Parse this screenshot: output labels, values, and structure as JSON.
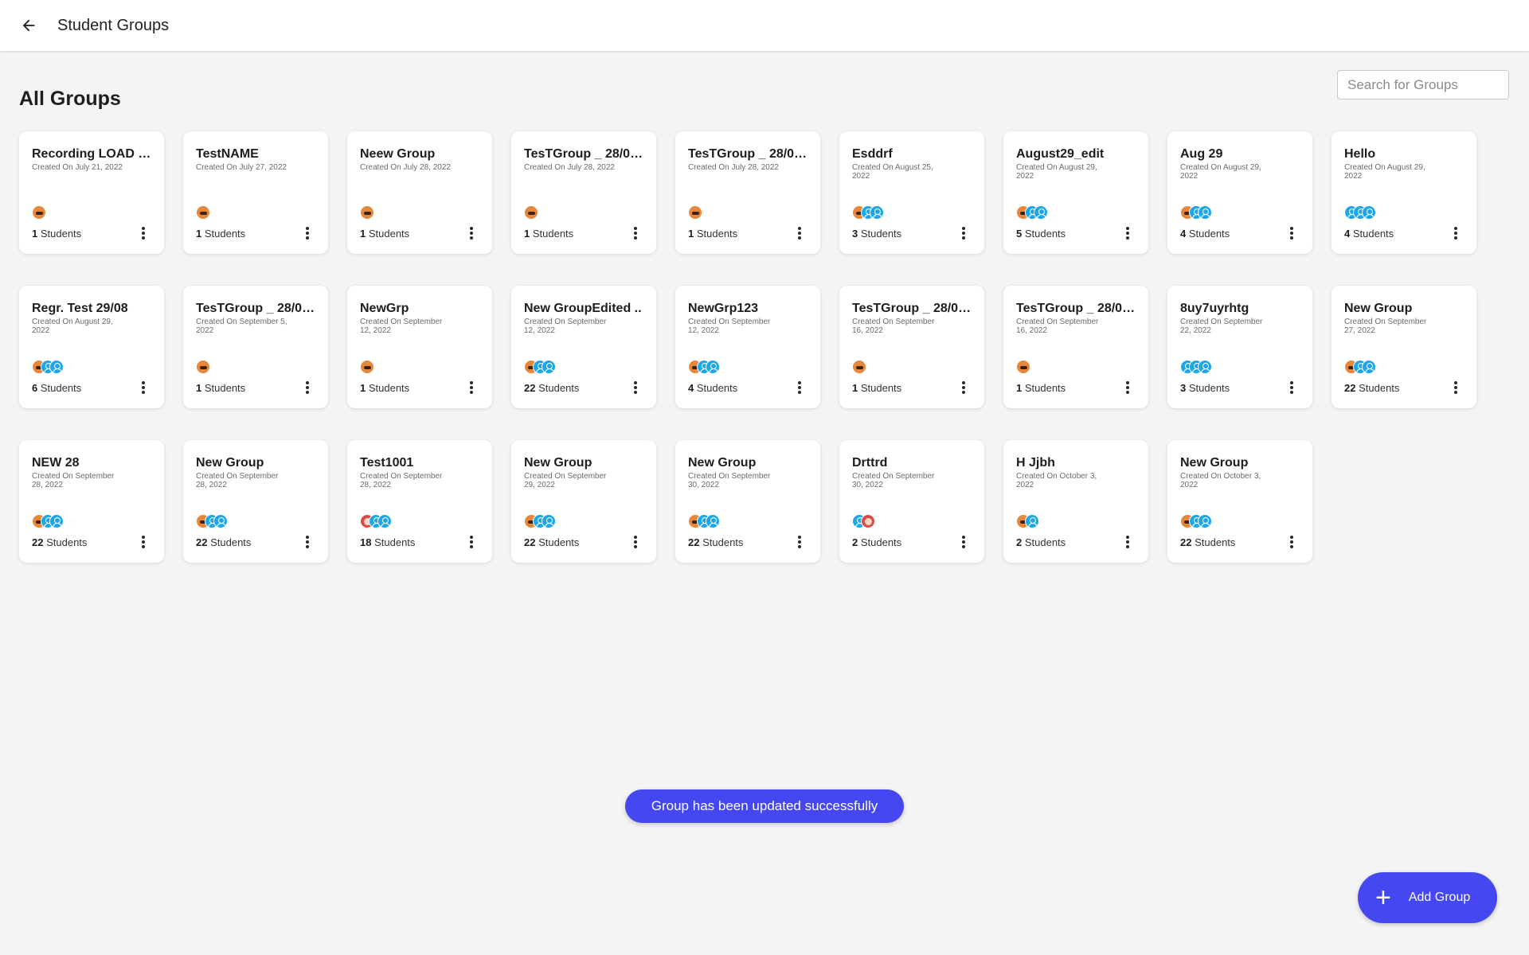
{
  "header": {
    "title": "Student Groups",
    "back_icon": "arrow-left-icon"
  },
  "section_title": "All Groups",
  "search": {
    "placeholder": "Search for Groups",
    "value": ""
  },
  "students_suffix": "Students",
  "groups": [
    {
      "name": "Recording LOAD T..",
      "created": "Created On July 21, 2022",
      "count": "1",
      "avatars": [
        "photo"
      ]
    },
    {
      "name": "TestNAME",
      "created": "Created On July 27, 2022",
      "count": "1",
      "avatars": [
        "photo"
      ]
    },
    {
      "name": "Neew Group",
      "created": "Created On July 28, 2022",
      "count": "1",
      "avatars": [
        "photo"
      ]
    },
    {
      "name": "TesTGroup _ 28/07..",
      "created": "Created On July 28, 2022",
      "count": "1",
      "avatars": [
        "photo"
      ]
    },
    {
      "name": "TesTGroup _ 28/07..",
      "created": "Created On July 28, 2022",
      "count": "1",
      "avatars": [
        "photo"
      ]
    },
    {
      "name": "Esddrf",
      "created": "Created On August 25, 2022",
      "count": "3",
      "avatars": [
        "photo",
        "default",
        "default"
      ]
    },
    {
      "name": "August29_edit",
      "created": "Created On August 29, 2022",
      "count": "5",
      "avatars": [
        "photo",
        "default",
        "default"
      ]
    },
    {
      "name": "Aug 29",
      "created": "Created On August 29, 2022",
      "count": "4",
      "avatars": [
        "photo",
        "default",
        "default"
      ]
    },
    {
      "name": "Hello",
      "created": "Created On August 29, 2022",
      "count": "4",
      "avatars": [
        "default",
        "default",
        "default"
      ]
    },
    {
      "name": "Regr. Test 29/08",
      "created": "Created On August 29, 2022",
      "count": "6",
      "avatars": [
        "photo",
        "default",
        "default"
      ]
    },
    {
      "name": "TesTGroup _ 28/07..",
      "created": "Created On September 5, 2022",
      "count": "1",
      "avatars": [
        "photo"
      ]
    },
    {
      "name": "NewGrp",
      "created": "Created On September 12, 2022",
      "count": "1",
      "avatars": [
        "photo"
      ]
    },
    {
      "name": "New GroupEdited ..",
      "created": "Created On September 12, 2022",
      "count": "22",
      "avatars": [
        "photo",
        "default",
        "default"
      ]
    },
    {
      "name": "NewGrp123",
      "created": "Created On September 12, 2022",
      "count": "4",
      "avatars": [
        "photo",
        "default",
        "default"
      ]
    },
    {
      "name": "TesTGroup _ 28/07..",
      "created": "Created On September 16, 2022",
      "count": "1",
      "avatars": [
        "photo"
      ]
    },
    {
      "name": "TesTGroup _ 28/07..",
      "created": "Created On September 16, 2022",
      "count": "1",
      "avatars": [
        "photo"
      ]
    },
    {
      "name": "8uy7uyrhtg",
      "created": "Created On September 22, 2022",
      "count": "3",
      "avatars": [
        "default",
        "default",
        "default"
      ]
    },
    {
      "name": "New Group",
      "created": "Created On September 27, 2022",
      "count": "22",
      "avatars": [
        "photo",
        "default",
        "default"
      ]
    },
    {
      "name": "NEW 28",
      "created": "Created On September 28, 2022",
      "count": "22",
      "avatars": [
        "photo",
        "default",
        "default"
      ]
    },
    {
      "name": "New Group",
      "created": "Created On September 28, 2022",
      "count": "22",
      "avatars": [
        "photo",
        "default",
        "default"
      ]
    },
    {
      "name": "Test1001",
      "created": "Created On September 28, 2022",
      "count": "18",
      "avatars": [
        "photo2",
        "default",
        "default"
      ]
    },
    {
      "name": "New Group",
      "created": "Created On September 29, 2022",
      "count": "22",
      "avatars": [
        "photo",
        "default",
        "default"
      ]
    },
    {
      "name": "New Group",
      "created": "Created On September 30, 2022",
      "count": "22",
      "avatars": [
        "photo",
        "default",
        "default"
      ]
    },
    {
      "name": "Drttrd",
      "created": "Created On September 30, 2022",
      "count": "2",
      "avatars": [
        "default",
        "photo2"
      ]
    },
    {
      "name": "H Jjbh",
      "created": "Created On October 3, 2022",
      "count": "2",
      "avatars": [
        "photo",
        "default"
      ]
    },
    {
      "name": "New Group",
      "created": "Created On October 3, 2022",
      "count": "22",
      "avatars": [
        "photo",
        "default",
        "default"
      ]
    }
  ],
  "toast": {
    "message": "Group has been updated successfully"
  },
  "fab": {
    "label": "Add Group",
    "icon": "plus-icon"
  },
  "colors": {
    "accent": "#4547f0",
    "avatar_default": "#1ea7e8",
    "background": "#f4f4f4"
  }
}
